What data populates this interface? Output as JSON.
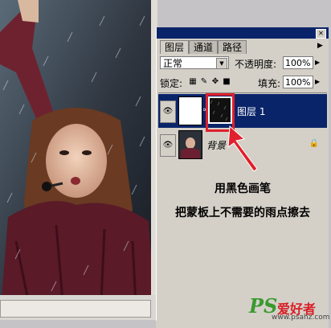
{
  "panel": {
    "tabs": [
      "图层",
      "通道",
      "路径"
    ],
    "blend_mode": "正常",
    "opacity_label": "不透明度:",
    "opacity_value": "100%",
    "lock_label": "锁定:",
    "fill_label": "填充:",
    "fill_value": "100%"
  },
  "layers": [
    {
      "name": "图层 1",
      "selected": true,
      "visible": true,
      "has_mask": true
    },
    {
      "name": "背景",
      "selected": false,
      "visible": true,
      "locked": true
    }
  ],
  "annotation": {
    "line1": "用黑色画笔",
    "line2": "把蒙板上不需要的雨点擦去"
  },
  "watermark": {
    "ps": "PS",
    "cn": "爱好者",
    "url": "www.psahz.com"
  },
  "colors": {
    "selection": "#0a246a",
    "highlight": "#e0202c",
    "panel_bg": "#d4d0c8"
  }
}
